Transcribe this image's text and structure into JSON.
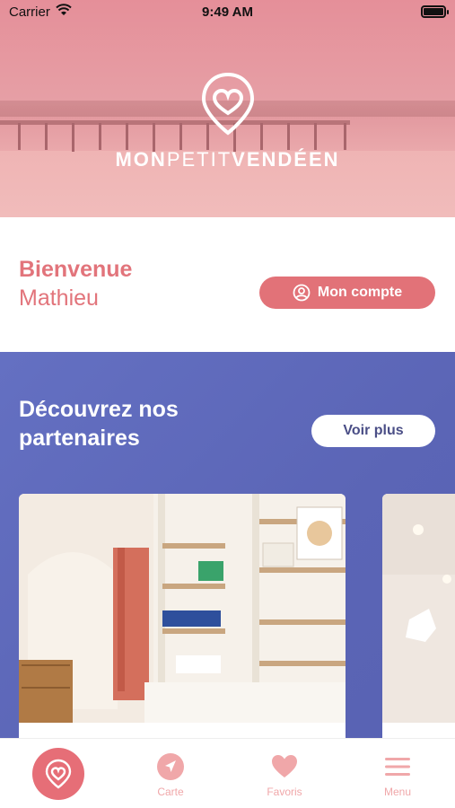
{
  "status_bar": {
    "carrier": "Carrier",
    "time": "9:49 AM"
  },
  "header": {
    "brand_bold_1": "MON",
    "brand_light": "PETIT",
    "brand_bold_2": "VENDÉEN"
  },
  "welcome": {
    "greeting": "Bienvenue",
    "user_name": "Mathieu",
    "account_button": "Mon compte"
  },
  "partners": {
    "title": "Découvrez nos partenaires",
    "more_button": "Voir plus"
  },
  "tabbar": {
    "carte": "Carte",
    "favoris": "Favoris",
    "menu": "Menu"
  },
  "colors": {
    "accent": "#e27278",
    "partners_bg": "#5b65b6",
    "tab_label": "#f0a7a9"
  },
  "icons": [
    "heart-pin-logo-icon",
    "user-circle-icon",
    "navigation-arrow-icon",
    "heart-icon",
    "hamburger-menu-icon"
  ]
}
